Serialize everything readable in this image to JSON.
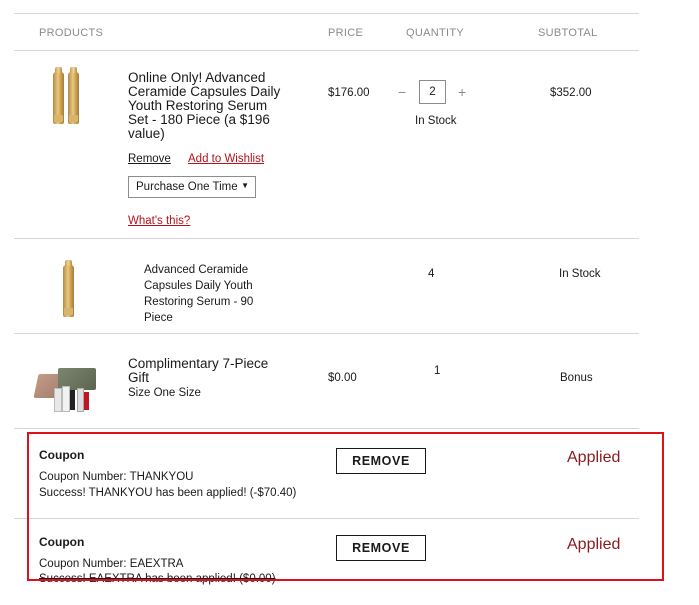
{
  "headers": {
    "products": "PRODUCTS",
    "price": "PRICE",
    "quantity": "QUANTITY",
    "subtotal": "SUBTOTAL"
  },
  "items": [
    {
      "name_lines": [
        "Online Only! Advanced",
        "Ceramide Capsules Daily",
        "Youth Restoring Serum",
        "Set - 180 Piece (a $196",
        "value)"
      ],
      "price": "$176.00",
      "quantity": "2",
      "minus": "−",
      "plus": "+",
      "stock": "In Stock",
      "subtotal": "$352.00",
      "remove_label": "Remove",
      "wishlist_label": "Add to Wishlist",
      "purchase_option": "Purchase One Time",
      "whats_this": "What's this?"
    },
    {
      "name_lines": [
        "Advanced Ceramide",
        "Capsules Daily Youth",
        "Restoring Serum - 90",
        "Piece"
      ],
      "quantity": "4",
      "stock": "In Stock"
    },
    {
      "name_lines": [
        "Complimentary 7-Piece",
        "Gift"
      ],
      "size": "Size One Size",
      "price": "$0.00",
      "quantity": "1",
      "subtotal": "Bonus"
    }
  ],
  "coupons": [
    {
      "title": "Coupon",
      "number": "Coupon Number: THANKYOU",
      "message": "Success! THANKYOU has been applied! (-$70.40)",
      "button": "REMOVE",
      "status": "Applied"
    },
    {
      "title": "Coupon",
      "number": "Coupon Number: EAEXTRA",
      "message": "Success! EAEXTRA has been applied! ($0.00)",
      "button": "REMOVE",
      "status": "Applied"
    }
  ],
  "colors": {
    "link_red": "#b5121b",
    "applied_text": "#8a1a1f",
    "highlight_border": "#e0101a"
  }
}
